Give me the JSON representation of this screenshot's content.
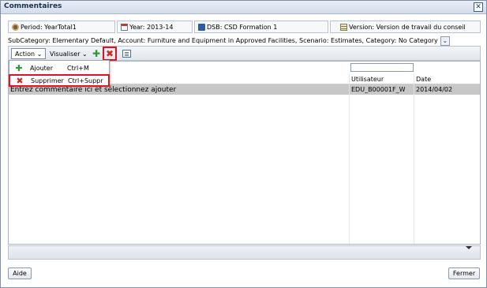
{
  "window": {
    "title": "Commentaires",
    "close_glyph": "✕"
  },
  "pov": [
    {
      "icon": "pov-icon",
      "label": "Period: YearTotal1"
    },
    {
      "icon": "calendar-icon",
      "label": "Year: 2013-14"
    },
    {
      "icon": "network-icon",
      "label": "DSB: CSD Formation 1"
    },
    {
      "icon": "version-icon",
      "label": "Version: Version de travail du conseil"
    }
  ],
  "subcategory": {
    "text": "SubCategory: Elementary Default, Account: Furniture and Equipment in Approved Facilities, Scenario: Estimates, Category: No Category"
  },
  "toolbar": {
    "action_label": "Action",
    "view_label": "Visualiser",
    "add_icon": "add-icon",
    "delete_icon": "delete-icon",
    "edit_icon": "edit-icon"
  },
  "menu": {
    "items": [
      {
        "label": "Ajouter",
        "shortcut": "Ctrl+M",
        "icon": "add-icon"
      },
      {
        "label": "Supprimer",
        "shortcut": "Ctrl+Suppr",
        "icon": "delete-icon"
      }
    ]
  },
  "table": {
    "columns": [
      "Utilisateur",
      "Date"
    ],
    "rows": [
      {
        "comment": "Entrez commentaire ici et sélectionnez ajouter",
        "user": "EDU_B00001F_W",
        "date": "2014/04/02"
      }
    ]
  },
  "footer": {
    "help_label": "Aide",
    "close_label": "Fermer"
  },
  "colors": {
    "highlight_border": "#e0141e",
    "selected_row": "#c7c7c7",
    "accent": "#1e3c78"
  }
}
